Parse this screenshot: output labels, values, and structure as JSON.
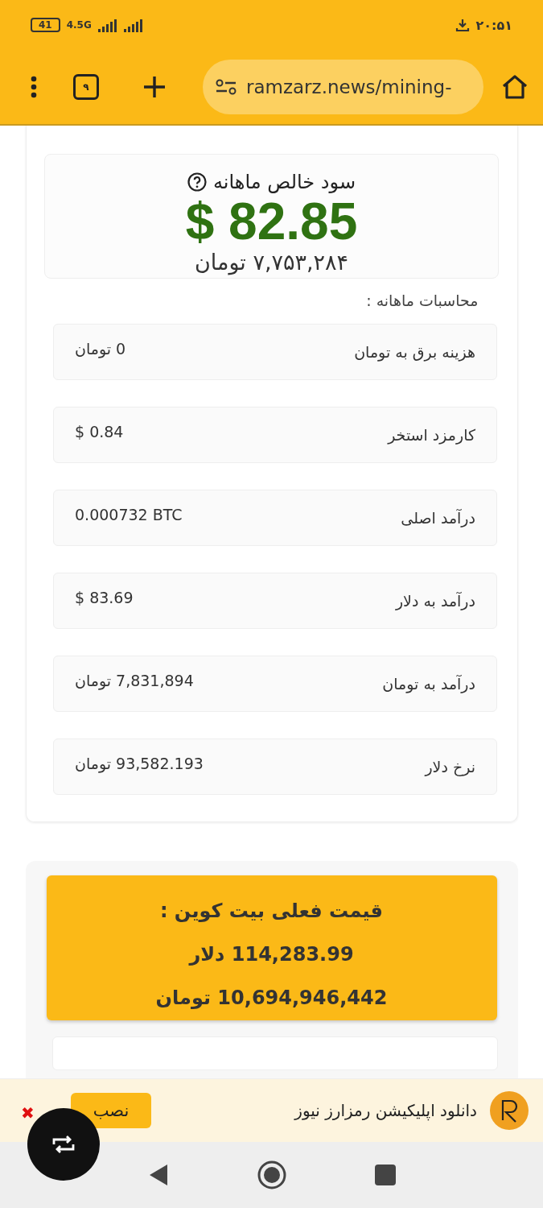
{
  "status_bar": {
    "battery": "41",
    "network": "4.5G",
    "time": "۲۰:۵۱"
  },
  "browser": {
    "tab_count": "۹",
    "url": "ramzarz.news/mining-"
  },
  "profit": {
    "title": "سود خالص ماهانه",
    "usd": "$ 82.85",
    "toman": "۷,۷۵۳,۲۸۴ تومان"
  },
  "section_label": "محاسبات ماهانه :",
  "rows": [
    {
      "label": "هزینه برق به تومان",
      "value": "0 تومان"
    },
    {
      "label": "کارمزد استخر",
      "value": "$ 0.84"
    },
    {
      "label": "درآمد اصلی",
      "value": "0.000732 BTC"
    },
    {
      "label": "درآمد به دلار",
      "value": "$ 83.69"
    },
    {
      "label": "درآمد به تومان",
      "value": "7,831,894 تومان"
    },
    {
      "label": "نرخ دلار",
      "value": "93,582.193 تومان"
    }
  ],
  "price": {
    "title": "قیمت فعلی بیت کوین :",
    "usd": "114,283.99 دلار",
    "toman": "10,694,946,442 تومان"
  },
  "banner": {
    "text": "دانلود اپلیکیشن رمزارز نیوز",
    "button": "نصب",
    "close": "✖"
  }
}
